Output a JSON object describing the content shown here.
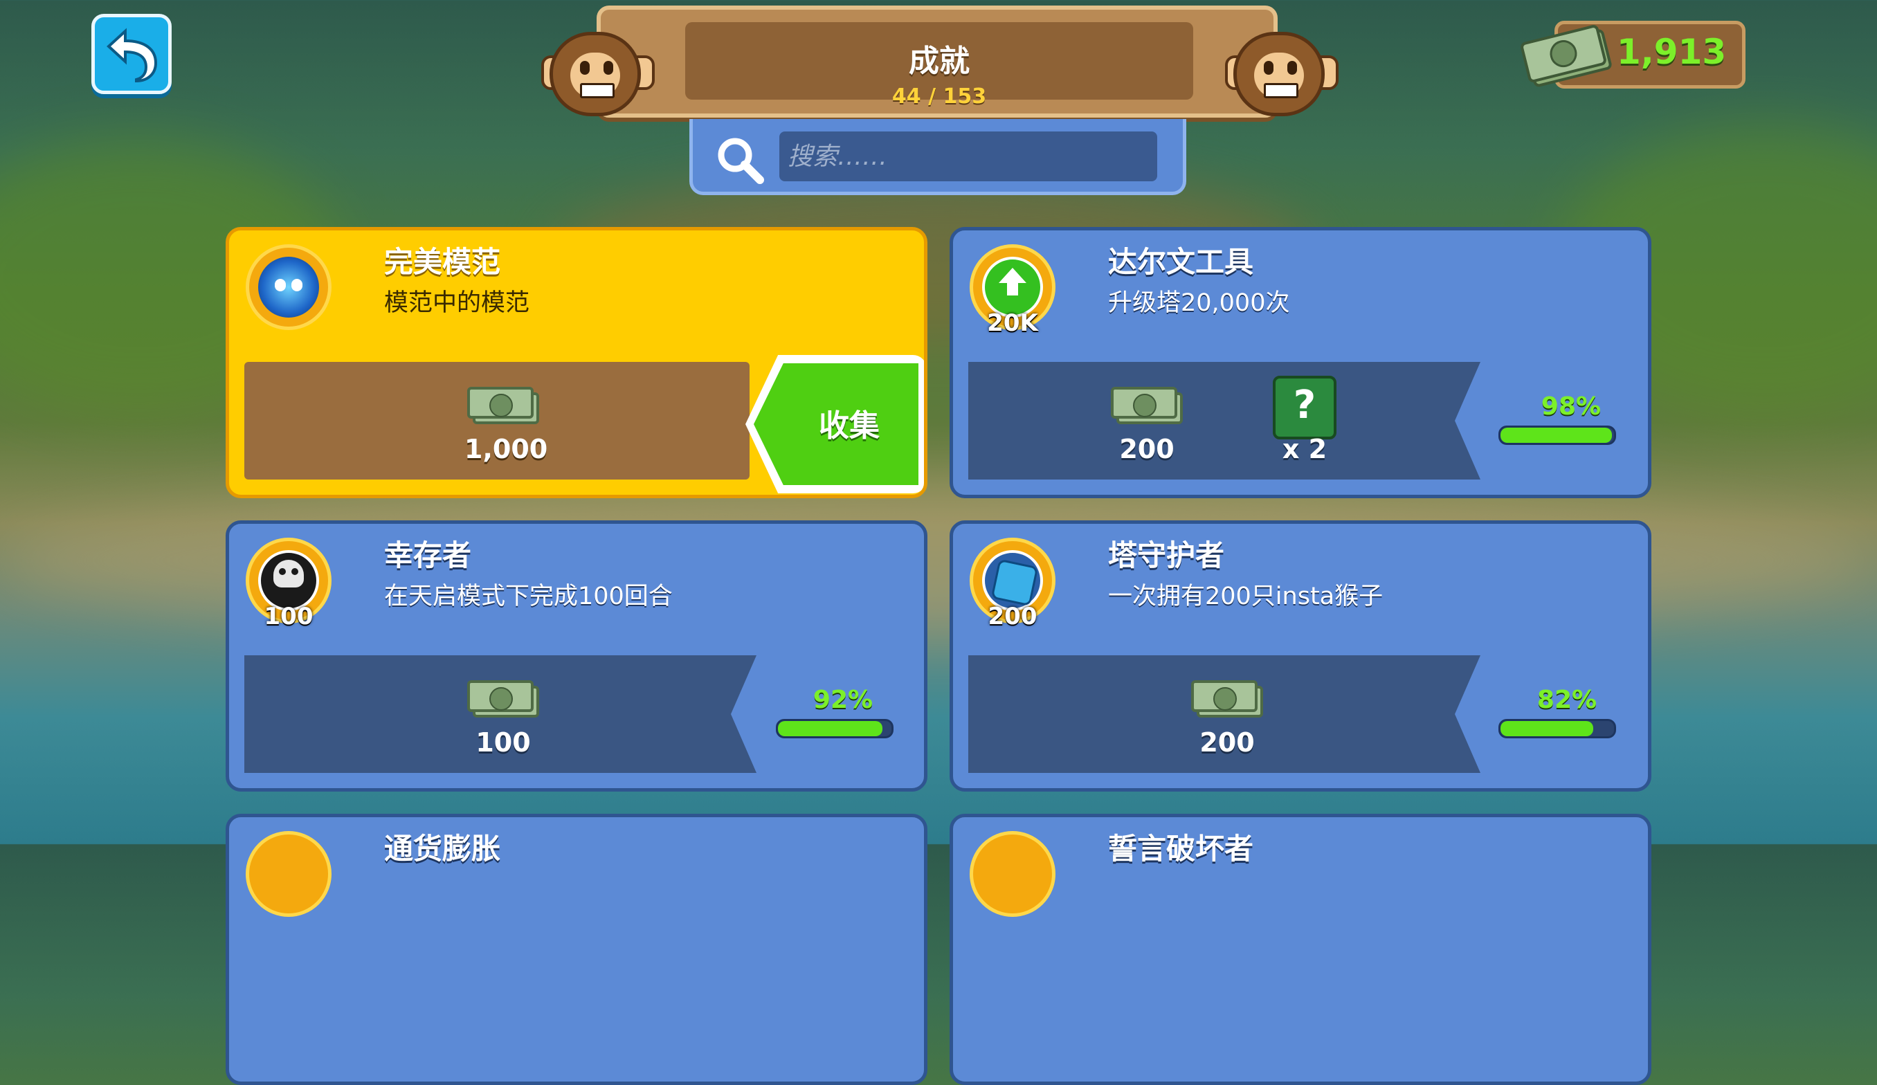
{
  "header": {
    "title": "成就",
    "progress": "44 / 153"
  },
  "search": {
    "placeholder": "搜索……"
  },
  "currency": {
    "amount": "1,913"
  },
  "colors": {
    "gold_card": "#ffcd00",
    "blue_card": "#5c8ad6",
    "progress_green": "#5ee41a",
    "cash_text": "#7cf02a"
  },
  "achievements": [
    {
      "name": "完美模范",
      "description": "模范中的模范",
      "reward": "1,000",
      "action": "收集",
      "icon": "perfect-monkey-medal-icon"
    },
    {
      "name": "达尔文工具",
      "description": "升级塔20,000次",
      "badge_label": "20K",
      "reward": "200",
      "extra_reward": "x 2",
      "progress_text": "98%",
      "progress": 0.98,
      "icon": "upgrade-arrow-medal-icon"
    },
    {
      "name": "幸存者",
      "description": "在天启模式下完成100回合",
      "badge_label": "100",
      "reward": "100",
      "progress_text": "92%",
      "progress": 0.92,
      "icon": "skull-medal-icon"
    },
    {
      "name": "塔守护者",
      "description": "一次拥有200只insta猴子",
      "badge_label": "200",
      "reward": "200",
      "progress_text": "82%",
      "progress": 0.82,
      "icon": "insta-monkey-medal-icon"
    },
    {
      "name": "通货膨胀",
      "icon": "medal-icon"
    },
    {
      "name": "誓言破坏者",
      "icon": "medal-icon"
    }
  ]
}
